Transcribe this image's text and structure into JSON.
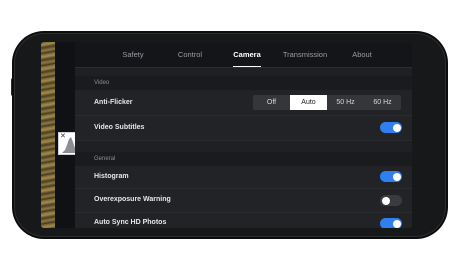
{
  "tabs": [
    "Safety",
    "Control",
    "Camera",
    "Transmission",
    "About"
  ],
  "active_tab": "Camera",
  "sections": {
    "video": "Video",
    "general": "General"
  },
  "rows": {
    "anti_flicker": {
      "label": "Anti-Flicker",
      "options": [
        "Off",
        "Auto",
        "50 Hz",
        "60 Hz"
      ],
      "selected": "Auto"
    },
    "video_subtitles": {
      "label": "Video Subtitles",
      "enabled": true
    },
    "histogram": {
      "label": "Histogram",
      "enabled": true
    },
    "overexposure_warning": {
      "label": "Overexposure Warning",
      "enabled": false
    },
    "auto_sync_hd_photos": {
      "label": "Auto Sync HD Photos",
      "enabled": true
    }
  },
  "histogram_widget": {
    "close_glyph": "✕"
  },
  "colors": {
    "accent": "#2f7ff0",
    "panel": "#1f2023",
    "phone": "#17181a"
  }
}
